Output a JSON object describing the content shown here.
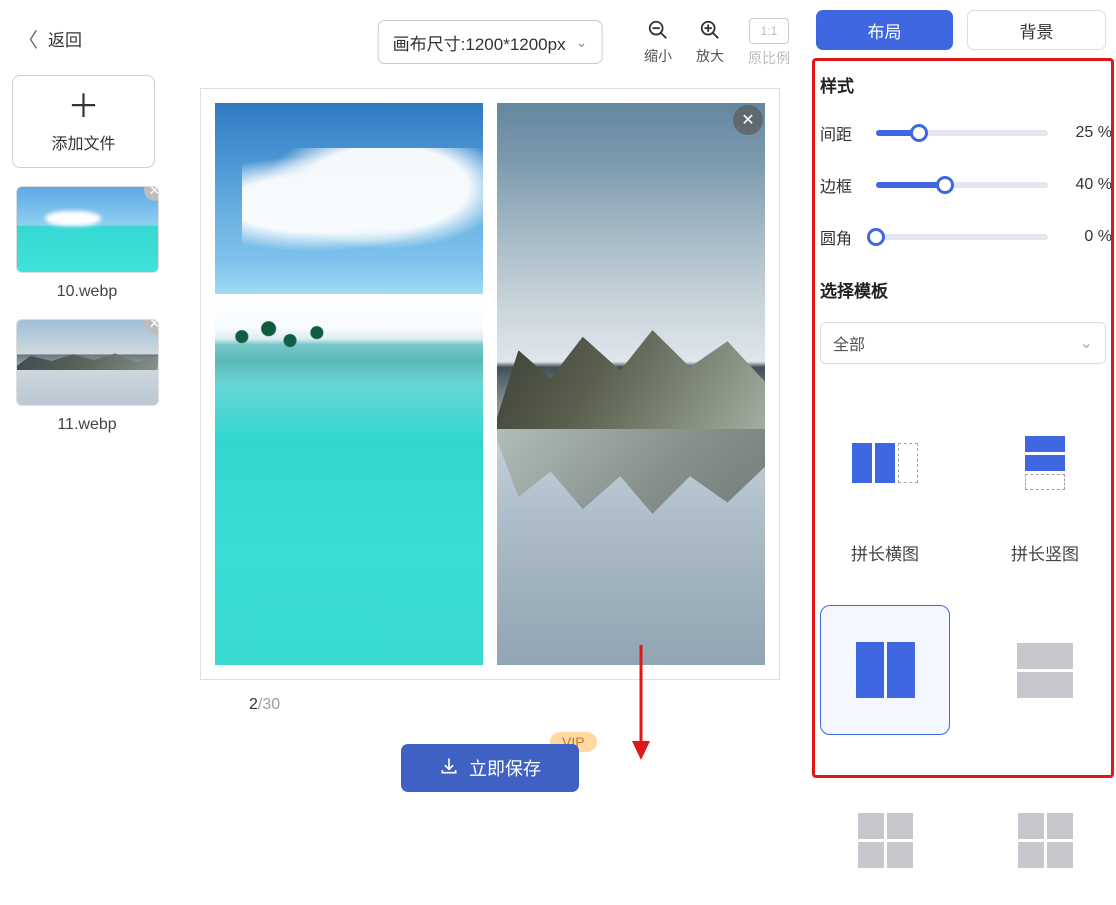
{
  "header": {
    "back_label": "返回",
    "canvas_size_label": "画布尺寸:1200*1200px",
    "zoom_out_label": "缩小",
    "zoom_in_label": "放大",
    "ratio_text": "1:1",
    "ratio_label": "原比例"
  },
  "left": {
    "add_file_label": "添加文件",
    "thumb_1_name": "10.webp",
    "thumb_2_name": "11.webp"
  },
  "counter": {
    "current": "2",
    "sep": "/",
    "total": "30"
  },
  "save_button_label": "立即保存",
  "vip_label": "VIP",
  "tabs": {
    "layout": "布局",
    "background": "背景"
  },
  "panel": {
    "style_title": "样式",
    "spacing_label": "间距",
    "spacing_value": "25 %",
    "spacing_pct": 25,
    "border_label": "边框",
    "border_value": "40 %",
    "border_pct": 40,
    "radius_label": "圆角",
    "radius_value": "0 %",
    "radius_pct": 0,
    "template_title": "选择模板",
    "template_select": "全部",
    "tpl_horizontal_label": "拼长横图",
    "tpl_vertical_label": "拼长竖图"
  }
}
